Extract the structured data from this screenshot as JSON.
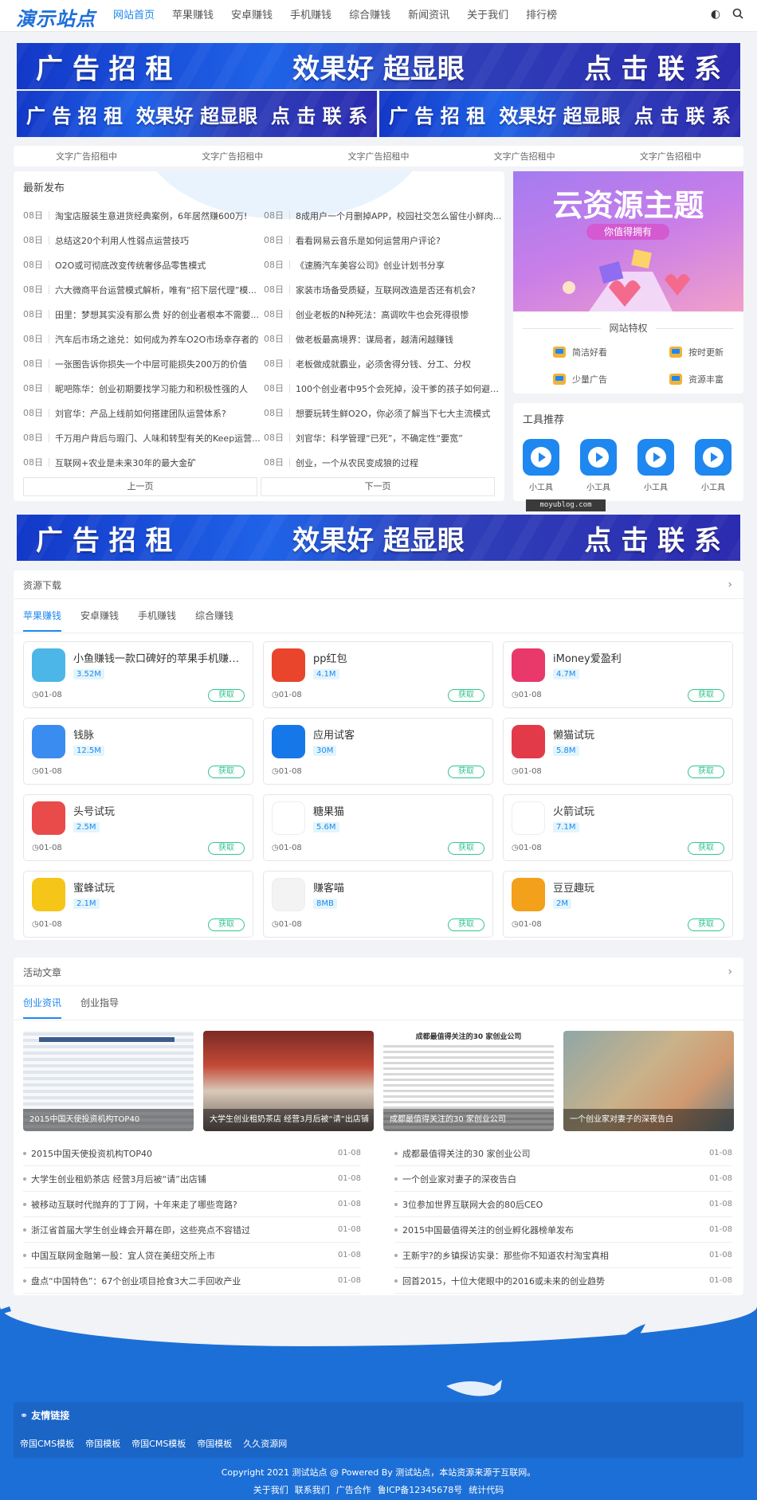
{
  "site": {
    "logo": "演示站点"
  },
  "nav": {
    "items": [
      "网站首页",
      "苹果赚钱",
      "安卓赚钱",
      "手机赚钱",
      "综合赚钱",
      "新闻资讯",
      "关于我们",
      "排行榜"
    ],
    "active": 0,
    "icons": [
      "theme-toggle-icon",
      "search-icon"
    ]
  },
  "banners": {
    "big": [
      "广 告 招 租",
      "效果好 超显眼",
      "点 击 联 系"
    ],
    "small": [
      "广 告 招 租",
      "效果好 超显眼",
      "点 击 联 系"
    ]
  },
  "text_ads": [
    "文字广告招租中",
    "文字广告招租中",
    "文字广告招租中",
    "文字广告招租中",
    "文字广告招租中"
  ],
  "latest": {
    "title": "最新发布",
    "left": [
      {
        "date": "08日",
        "title": "淘宝店服装生意进货经典案例，6年居然赚600万!"
      },
      {
        "date": "08日",
        "title": "总结这20个利用人性弱点运营技巧"
      },
      {
        "date": "08日",
        "title": "O2O或可彻底改变传统奢侈品零售模式"
      },
      {
        "date": "08日",
        "title": "六大微商平台运营模式解析，唯有“招下层代理”模..."
      },
      {
        "date": "08日",
        "title": "田里：梦想其实没有那么贵 好的创业者根本不需要..."
      },
      {
        "date": "08日",
        "title": "汽车后市场之途兑：如何成为养车O2O市场幸存者的"
      },
      {
        "date": "08日",
        "title": "一张图告诉你损失一个中层可能损失200万的价值"
      },
      {
        "date": "08日",
        "title": "昵吧陈华：创业初期要找学习能力和积极性强的人"
      },
      {
        "date": "08日",
        "title": "刘官华：产品上线前如何搭建团队运营体系?"
      },
      {
        "date": "08日",
        "title": "千万用户背后与瑕门、人味和转型有关的Keep运营..."
      },
      {
        "date": "08日",
        "title": "互联网+农业是未来30年的最大金矿"
      }
    ],
    "right": [
      {
        "date": "08日",
        "title": "8成用户一个月删掉APP，校园社交怎么留住小鲜肉..."
      },
      {
        "date": "08日",
        "title": "看看网易云音乐是如何运营用户评论?"
      },
      {
        "date": "08日",
        "title": "《速腾汽车美容公司》创业计划书分享"
      },
      {
        "date": "08日",
        "title": "家装市场备受质疑，互联网改造是否还有机会?"
      },
      {
        "date": "08日",
        "title": "创业老板的N种死法：高调吹牛也会死得很惨"
      },
      {
        "date": "08日",
        "title": "做老板最高境界：谋局者，越清闲越赚钱"
      },
      {
        "date": "08日",
        "title": "老板做成就霸业，必须舍得分钱、分工、分权"
      },
      {
        "date": "08日",
        "title": "100个创业者中95个会死掉，没干爹的孩子如何避免..."
      },
      {
        "date": "08日",
        "title": "想要玩转生鲜O2O，你必须了解当下七大主流模式"
      },
      {
        "date": "08日",
        "title": "刘官华：科学管理“已死”，不确定性“要宽”"
      },
      {
        "date": "08日",
        "title": "创业，一个从农民变成狼的过程"
      }
    ],
    "prev": "上一页",
    "next": "下一页"
  },
  "promo": {
    "title": "云资源主题",
    "pill": "你值得拥有",
    "features_title": "网站特权",
    "features": [
      "简洁好看",
      "按时更新",
      "少量广告",
      "资源丰富"
    ]
  },
  "tools": {
    "title": "工具推荐",
    "items": [
      "小工具",
      "小工具",
      "小工具",
      "小工具"
    ]
  },
  "watermark": "moyublog.com",
  "downloads": {
    "title": "资源下载",
    "arrow": "›",
    "tabs": [
      "苹果赚钱",
      "安卓赚钱",
      "手机赚钱",
      "综合赚钱"
    ],
    "get_label": "获取",
    "apps": [
      {
        "name": "小鱼赚钱一款口碑好的苹果手机赚钱...",
        "size": "3.52M",
        "date": "01-08",
        "color": "#4cb6e8"
      },
      {
        "name": "pp红包",
        "size": "4.1M",
        "date": "01-08",
        "color": "#e8452c"
      },
      {
        "name": "iMoney爱盈利",
        "size": "4.7M",
        "date": "01-08",
        "color": "#e9386a"
      },
      {
        "name": "钱脉",
        "size": "12.5M",
        "date": "01-08",
        "color": "#3a8cf0"
      },
      {
        "name": "应用试客",
        "size": "30M",
        "date": "01-08",
        "color": "#1677e8"
      },
      {
        "name": "懒猫试玩",
        "size": "5.8M",
        "date": "01-08",
        "color": "#e33a4a"
      },
      {
        "name": "头号试玩",
        "size": "2.5M",
        "date": "01-08",
        "color": "#e94b4b"
      },
      {
        "name": "糖果猫",
        "size": "5.6M",
        "date": "01-08",
        "color": "#ffffff"
      },
      {
        "name": "火箭试玩",
        "size": "7.1M",
        "date": "01-08",
        "color": "#ffffff"
      },
      {
        "name": "蜜蜂试玩",
        "size": "2.1M",
        "date": "01-08",
        "color": "#f5c518"
      },
      {
        "name": "赚客喵",
        "size": "8MB",
        "date": "01-08",
        "color": "#f3f3f3"
      },
      {
        "name": "豆豆趣玩",
        "size": "2M",
        "date": "01-08",
        "color": "#f3a01a"
      }
    ]
  },
  "articles": {
    "title": "活动文章",
    "arrow": "›",
    "tabs": [
      "创业资讯",
      "创业指导"
    ],
    "thumbs": [
      "2015中国天使投资机构TOP40",
      "大学生创业租奶茶店 经营3月后被“请”出店铺",
      "成都最值得关注的30 家创业公司",
      "一个创业家对妻子的深夜告白"
    ],
    "left": [
      {
        "title": "2015中国天使投资机构TOP40",
        "date": "01-08"
      },
      {
        "title": "大学生创业租奶茶店 经营3月后被“请”出店铺",
        "date": "01-08"
      },
      {
        "title": "被移动互联时代抛弃的丁丁网，十年来走了哪些弯路?",
        "date": "01-08"
      },
      {
        "title": "浙江省首届大学生创业峰会开幕在即，这些亮点不容错过",
        "date": "01-08"
      },
      {
        "title": "中国互联网金融第一股：宜人贷在美纽交所上市",
        "date": "01-08"
      },
      {
        "title": "盘点“中国特色”：67个创业项目抢食3大二手回收产业",
        "date": "01-08"
      }
    ],
    "right": [
      {
        "title": "成都最值得关注的30 家创业公司",
        "date": "01-08"
      },
      {
        "title": "一个创业家对妻子的深夜告白",
        "date": "01-08"
      },
      {
        "title": "3位参加世界互联网大会的80后CEO",
        "date": "01-08"
      },
      {
        "title": "2015中国最值得关注的创业孵化器榜单发布",
        "date": "01-08"
      },
      {
        "title": "王新宇?的乡镇探访实录：那些你不知道农村淘宝真相",
        "date": "01-08"
      },
      {
        "title": "回首2015，十位大佬眼中的2016或未来的创业趋势",
        "date": "01-08"
      }
    ]
  },
  "footer": {
    "links_title": "友情链接",
    "links": [
      "帝国CMS模板",
      "帝国模板",
      "帝国CMS模板",
      "帝国模板",
      "久久资源网"
    ],
    "copyright": "Copyright 2021 测试站点 @ Powered By 测试站点，本站资源来源于互联网。",
    "bottom": [
      "关于我们",
      "联系我们",
      "广告合作",
      "鲁ICP备12345678号",
      "统计代码"
    ]
  }
}
